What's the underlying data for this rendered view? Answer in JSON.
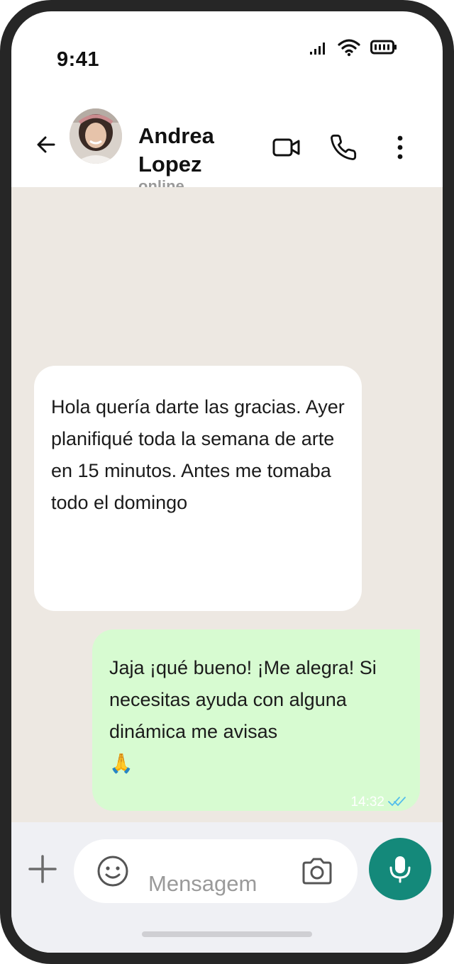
{
  "status_bar": {
    "time": "9:41"
  },
  "contact": {
    "name": "Andrea Lopez",
    "status": "online"
  },
  "messages": [
    {
      "direction": "incoming",
      "text": "Hola quería darte las gracias. Ayer planifiqué toda la semana de arte en 15 minutos. Antes me tomaba todo el domingo"
    },
    {
      "direction": "outgoing",
      "text": "Jaja ¡qué bueno! ¡Me alegra! Si necesitas ayuda con alguna dinámica me avisas",
      "emoji": "🙏",
      "time": "14:32",
      "read": true
    }
  ],
  "composer": {
    "placeholder": "Mensagem"
  },
  "icons": {
    "back": "back-arrow-icon",
    "video": "video-call-icon",
    "phone": "phone-icon",
    "more": "more-vertical-icon",
    "add": "plus-icon",
    "emoji": "emoji-icon",
    "camera": "camera-icon",
    "mic": "microphone-icon"
  },
  "colors": {
    "chat_bg": "#ede8e2",
    "incoming_bubble": "#ffffff",
    "outgoing_bubble": "#d7fbd1",
    "accent": "#14897a",
    "read_ticks": "#53bdeb"
  }
}
